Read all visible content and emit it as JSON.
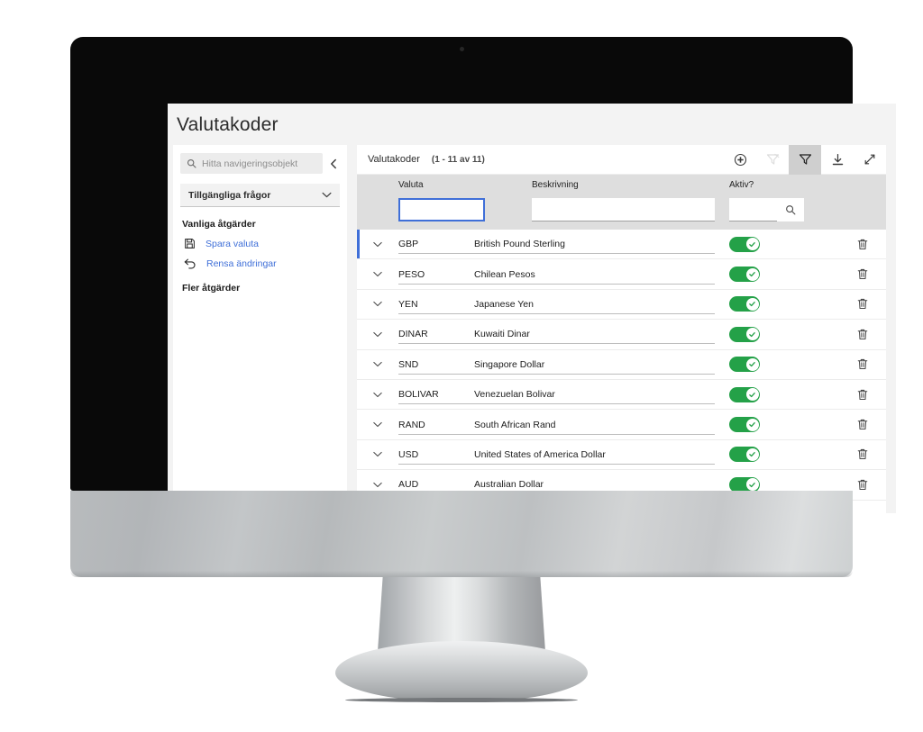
{
  "page": {
    "title": "Valutakoder"
  },
  "sidebar": {
    "search": {
      "placeholder": "Hitta navigeringsobjekt",
      "value": "",
      "icon": "search-icon"
    },
    "collapse_icon": "chevron-left-icon",
    "queries_select": {
      "label": "Tillgängliga frågor",
      "icon": "chevron-down-icon"
    },
    "common_actions_heading": "Vanliga åtgärder",
    "actions": [
      {
        "label": "Spara valuta",
        "icon": "save-icon"
      },
      {
        "label": "Rensa ändringar",
        "icon": "undo-icon"
      }
    ],
    "more_actions_heading": "Fler åtgärder"
  },
  "grid": {
    "title": "Valutakoder",
    "count": "(1 - 11 av 11)",
    "toolbar": [
      {
        "name": "add-row-button",
        "icon": "circle-plus-icon",
        "state": "enabled"
      },
      {
        "name": "clear-filter-button",
        "icon": "filter-off-icon",
        "state": "disabled"
      },
      {
        "name": "filter-button",
        "icon": "filter-icon",
        "state": "active"
      },
      {
        "name": "download-button",
        "icon": "download-icon",
        "state": "enabled"
      },
      {
        "name": "expand-button",
        "icon": "expand-diagonal-icon",
        "state": "enabled"
      }
    ],
    "columns": [
      {
        "key": "code",
        "label": "Valuta"
      },
      {
        "key": "description",
        "label": "Beskrivning"
      },
      {
        "key": "active",
        "label": "Aktiv?"
      }
    ],
    "filters": {
      "code": {
        "value": "",
        "focused": true
      },
      "description": {
        "value": ""
      },
      "active": {
        "value": "",
        "search_icon": "search-icon"
      }
    },
    "row_icons": {
      "expand": "chevron-down-icon",
      "delete": "trash-icon",
      "toggle_on": "check-circle-icon"
    },
    "rows": [
      {
        "code": "GBP",
        "description": "British Pound Sterling",
        "active": true,
        "selected": true
      },
      {
        "code": "PESO",
        "description": "Chilean Pesos",
        "active": true,
        "selected": false
      },
      {
        "code": "YEN",
        "description": "Japanese Yen",
        "active": true,
        "selected": false
      },
      {
        "code": "DINAR",
        "description": "Kuwaiti Dinar",
        "active": true,
        "selected": false
      },
      {
        "code": "SND",
        "description": "Singapore Dollar",
        "active": true,
        "selected": false
      },
      {
        "code": "BOLIVAR",
        "description": "Venezuelan Bolivar",
        "active": true,
        "selected": false
      },
      {
        "code": "RAND",
        "description": "South African Rand",
        "active": true,
        "selected": false
      },
      {
        "code": "USD",
        "description": "United States of America Dollar",
        "active": true,
        "selected": false
      },
      {
        "code": "AUD",
        "description": "Australian Dollar",
        "active": true,
        "selected": false
      }
    ]
  },
  "colors": {
    "accent_blue": "#3f6fd8",
    "toggle_green": "#24a148",
    "page_bg": "#f3f3f3",
    "filter_header_bg": "#dedede",
    "bezel": "#090909"
  }
}
